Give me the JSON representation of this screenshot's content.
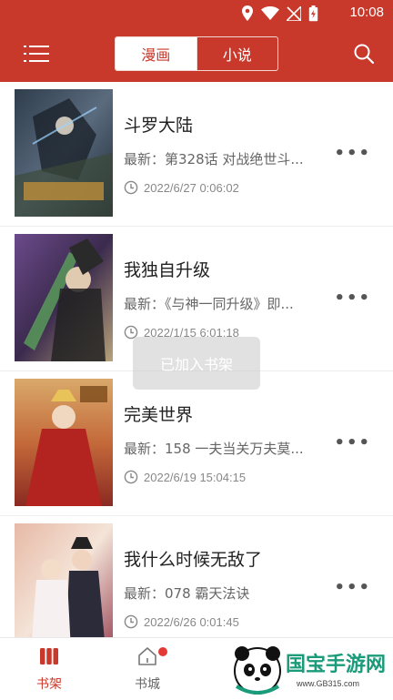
{
  "status_bar": {
    "time": "10:08"
  },
  "header": {
    "tabs": [
      {
        "label": "漫画",
        "active": true
      },
      {
        "label": "小说",
        "active": false
      }
    ],
    "accent_color": "#c8392b"
  },
  "comics": [
    {
      "title": "斗罗大陆",
      "latest": "最新：第328话 对战绝世斗...",
      "updated": "2022/6/27 0:06:02"
    },
    {
      "title": "我独自升级",
      "latest": "最新：《与神一同升级》即...",
      "updated": "2022/1/15 6:01:18"
    },
    {
      "title": "完美世界",
      "latest": "最新：158 一夫当关万夫莫...",
      "updated": "2022/6/19 15:04:15"
    },
    {
      "title": "我什么时候无敌了",
      "latest": "最新：078 霸天法诀",
      "updated": "2022/6/26 0:01:45"
    }
  ],
  "toast": {
    "text": "已加入书架"
  },
  "bottom_nav": {
    "items": [
      {
        "label": "书架",
        "active": true
      },
      {
        "label": "书城",
        "active": false,
        "badge": true
      }
    ]
  },
  "watermark": {
    "name": "国宝手游网",
    "url": "www.GB315.com"
  }
}
